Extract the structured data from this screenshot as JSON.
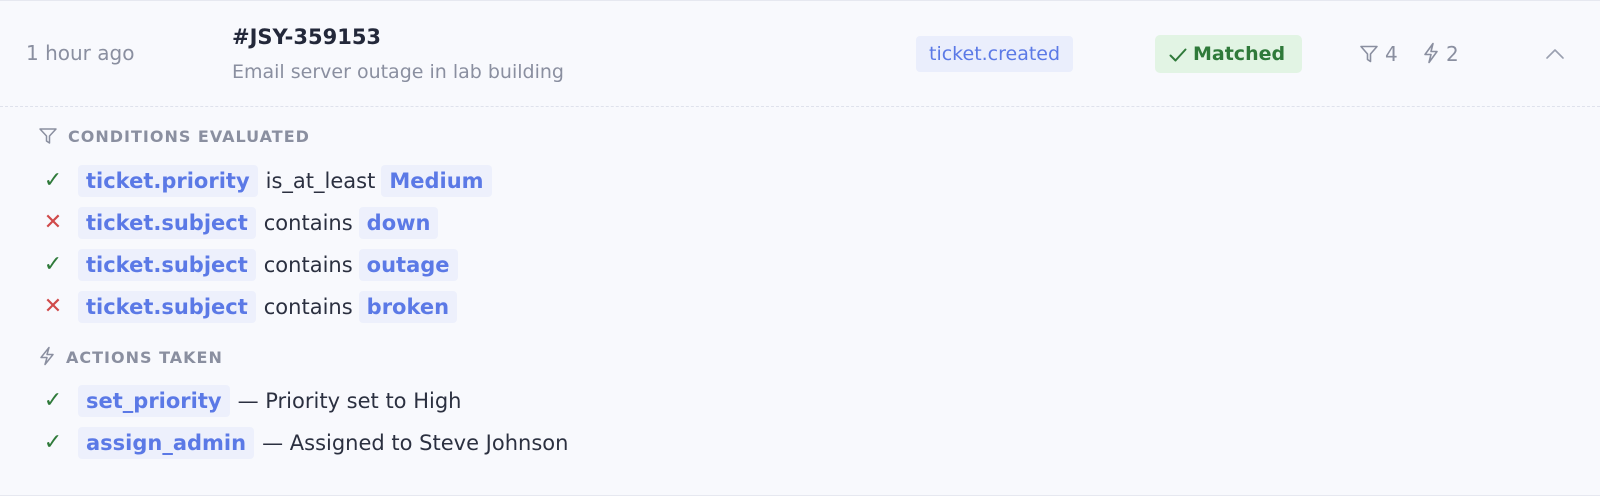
{
  "row": {
    "time": "1 hour ago",
    "ticket_id": "#JSY-359153",
    "ticket_subject": "Email server outage in lab building",
    "event": "ticket.created",
    "status": "Matched",
    "status_icon": "check-icon",
    "conditions_count": "4",
    "actions_count": "2",
    "collapse_icon": "chevron-up-icon"
  },
  "conditions": {
    "title": "CONDITIONS EVALUATED",
    "icon": "filter-icon",
    "items": [
      {
        "result": "pass",
        "mark": "✓",
        "field": "ticket.priority",
        "operator": "is_at_least",
        "value": "Medium"
      },
      {
        "result": "fail",
        "mark": "✕",
        "field": "ticket.subject",
        "operator": "contains",
        "value": "down"
      },
      {
        "result": "pass",
        "mark": "✓",
        "field": "ticket.subject",
        "operator": "contains",
        "value": "outage"
      },
      {
        "result": "fail",
        "mark": "✕",
        "field": "ticket.subject",
        "operator": "contains",
        "value": "broken"
      }
    ]
  },
  "actions": {
    "title": "ACTIONS TAKEN",
    "icon": "lightning-icon",
    "items": [
      {
        "result": "pass",
        "mark": "✓",
        "name": "set_priority",
        "description": "— Priority set to High"
      },
      {
        "result": "pass",
        "mark": "✓",
        "name": "assign_admin",
        "description": "— Assigned to Steve Johnson"
      }
    ]
  },
  "colors": {
    "accent": "#5b79e6",
    "success": "#2f7a3a",
    "success_bg": "#e2f4e4",
    "failure": "#d04a4a",
    "muted": "#8a8fa0"
  }
}
